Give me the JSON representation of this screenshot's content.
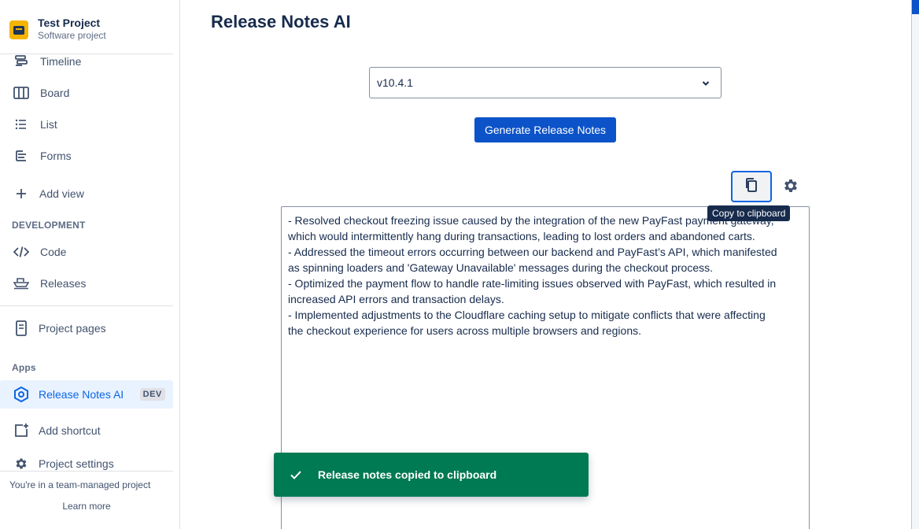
{
  "project": {
    "name": "Test Project",
    "type": "Software project"
  },
  "sidebar": {
    "items": [
      {
        "label": "Timeline",
        "icon": "timeline-icon"
      },
      {
        "label": "Board",
        "icon": "board-icon"
      },
      {
        "label": "List",
        "icon": "list-icon"
      },
      {
        "label": "Forms",
        "icon": "forms-icon"
      },
      {
        "label": "Add view",
        "icon": "plus-icon"
      }
    ],
    "development_title": "DEVELOPMENT",
    "dev_items": [
      {
        "label": "Code",
        "icon": "code-icon"
      },
      {
        "label": "Releases",
        "icon": "ship-icon"
      }
    ],
    "project_pages": "Project pages",
    "apps_title": "Apps",
    "app_item": {
      "label": "Release Notes AI",
      "badge": "DEV"
    },
    "add_shortcut": "Add shortcut",
    "project_settings": "Project settings",
    "footer_text": "You're in a team-managed project",
    "footer_link": "Learn more"
  },
  "main": {
    "title": "Release Notes AI",
    "version_value": "v10.4.1",
    "generate_label": "Generate Release Notes",
    "tooltip": "Copy to clipboard",
    "notes_lines": [
      "- Resolved checkout freezing issue caused by the integration of the new PayFast payment gateway,",
      "which would intermittently hang during transactions, leading to lost orders and abandoned carts.",
      "- Addressed the timeout errors occurring between our backend and PayFast’s API, which manifested",
      "as spinning loaders and 'Gateway Unavailable' messages during the checkout process.",
      "- Optimized the payment flow to handle rate-limiting issues observed with PayFast, which resulted in",
      "increased API errors and transaction delays.",
      "- Implemented adjustments to the Cloudflare caching setup to mitigate conflicts that were affecting",
      "the checkout experience for users across multiple browsers and regions."
    ],
    "toast_message": "Release notes copied to clipboard"
  },
  "colors": {
    "primary": "#0c53c9",
    "success": "#007a52",
    "active_bg": "#e9f2ff",
    "active_text": "#0c66e4"
  }
}
